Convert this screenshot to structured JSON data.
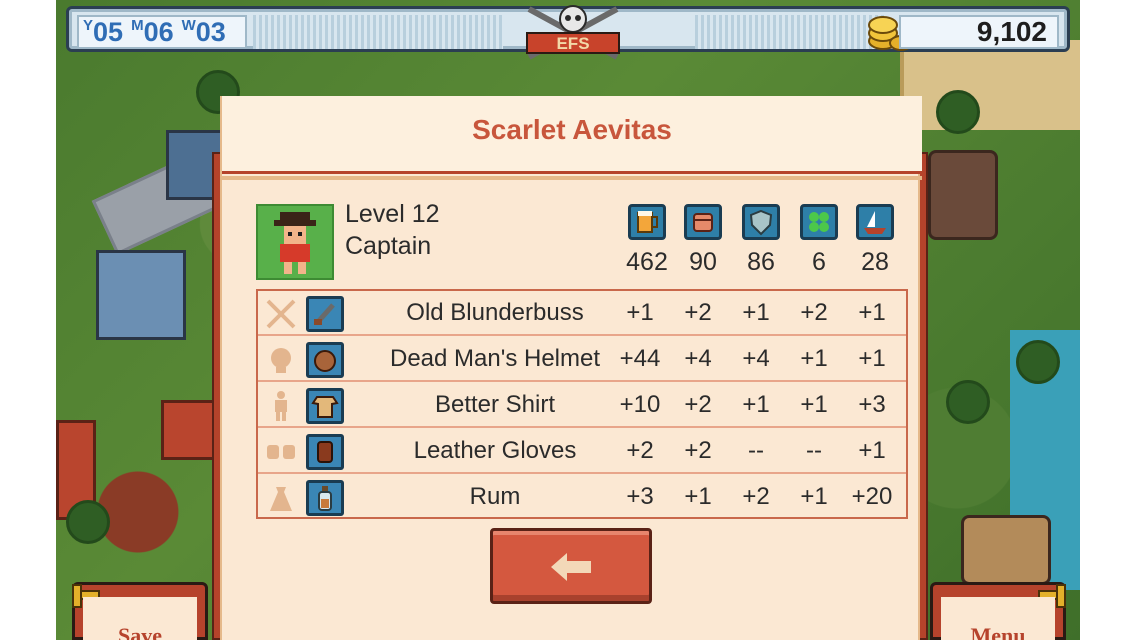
{
  "hud": {
    "date": {
      "year_prefix": "Y",
      "year": "05",
      "month_prefix": "M",
      "month": "06",
      "week_prefix": "W",
      "week": "03"
    },
    "emblem_text": "EFS",
    "gold": "9,102",
    "gold_icon": "gold-coins-icon"
  },
  "character": {
    "name": "Scarlet Aevitas",
    "level": "Level 12",
    "class": "Captain",
    "stats": [
      {
        "icon": "beer-mug-icon",
        "value": "462",
        "color": "#2e7fa8"
      },
      {
        "icon": "fist-icon",
        "value": "90",
        "color": "#2e7fa8"
      },
      {
        "icon": "shield-icon",
        "value": "86",
        "color": "#2e7fa8"
      },
      {
        "icon": "clover-icon",
        "value": "6",
        "color": "#2e7fa8"
      },
      {
        "icon": "ship-icon",
        "value": "28",
        "color": "#2e7fa8"
      }
    ]
  },
  "equipment": [
    {
      "slot_icon": "crossed-swords-icon",
      "item_icon": "blunderbuss-icon",
      "name": "Old Blunderbuss",
      "values": [
        "+1",
        "+2",
        "+1",
        "+2",
        "+1"
      ]
    },
    {
      "slot_icon": "head-icon",
      "item_icon": "helmet-icon",
      "name": "Dead Man's Helmet",
      "values": [
        "+44",
        "+4",
        "+4",
        "+1",
        "+1"
      ]
    },
    {
      "slot_icon": "body-icon",
      "item_icon": "shirt-icon",
      "name": "Better Shirt",
      "values": [
        "+10",
        "+2",
        "+1",
        "+1",
        "+3"
      ]
    },
    {
      "slot_icon": "hands-icon",
      "item_icon": "gloves-icon",
      "name": "Leather Gloves",
      "values": [
        "+2",
        "+2",
        "--",
        "--",
        "+1"
      ]
    },
    {
      "slot_icon": "bag-icon",
      "item_icon": "rum-bottle-icon",
      "name": "Rum",
      "values": [
        "+3",
        "+1",
        "+2",
        "+1",
        "+20"
      ]
    }
  ],
  "buttons": {
    "back_icon": "back-arrow-icon",
    "save_label": "Save",
    "menu_label": "Menu"
  }
}
